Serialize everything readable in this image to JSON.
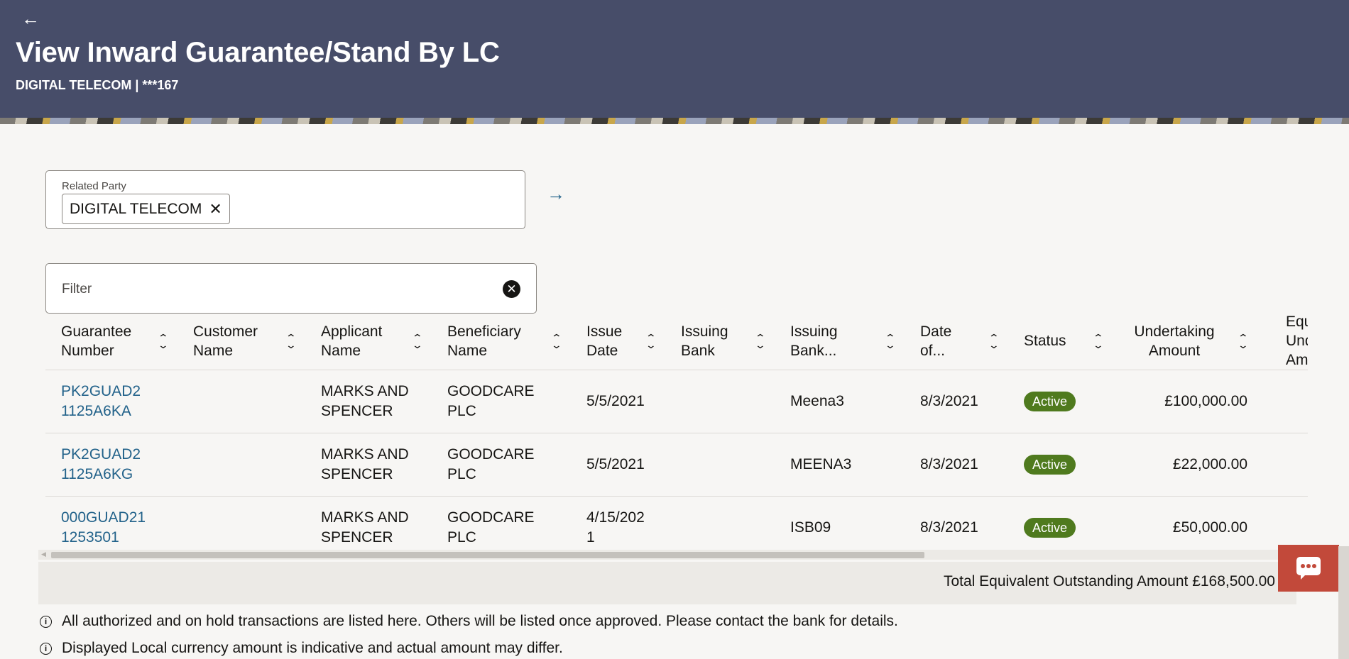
{
  "header": {
    "back_icon": "arrow-left-icon",
    "title": "View Inward Guarantee/Stand By LC",
    "subtitle": "DIGITAL TELECOM | ***167"
  },
  "related_party": {
    "label": "Related Party",
    "chip_value": "DIGITAL TELECOM",
    "remove_icon": "close-icon",
    "go_icon": "arrow-right-icon"
  },
  "filter": {
    "placeholder": "Filter",
    "clear_icon": "clear-circle-icon"
  },
  "table": {
    "columns": [
      "Guarantee Number",
      "Customer Name",
      "Applicant Name",
      "Beneficiary Name",
      "Issue Date",
      "Issuing Bank",
      "Issuing Bank...",
      "Date of...",
      "Status",
      "Undertaking Amount",
      "Equivalent Undertaking Amount"
    ],
    "rows": [
      {
        "guarantee_number": "PK2GUAD21125A6KA",
        "customer_name": "",
        "applicant_name": "MARKS AND SPENCER",
        "beneficiary_name": "GOODCARE PLC",
        "issue_date": "5/5/2021",
        "issuing_bank": "",
        "issuing_bank_ref": "Meena3",
        "date_of": "8/3/2021",
        "status": "Active",
        "undertaking_amount": "£100,000.00",
        "equivalent_amount": "£"
      },
      {
        "guarantee_number": "PK2GUAD21125A6KG",
        "customer_name": "",
        "applicant_name": "MARKS AND SPENCER",
        "beneficiary_name": "GOODCARE PLC",
        "issue_date": "5/5/2021",
        "issuing_bank": "",
        "issuing_bank_ref": "MEENA3",
        "date_of": "8/3/2021",
        "status": "Active",
        "undertaking_amount": "£22,000.00",
        "equivalent_amount": ""
      },
      {
        "guarantee_number": "000GUAD211253501",
        "customer_name": "",
        "applicant_name": "MARKS AND SPENCER",
        "beneficiary_name": "GOODCARE PLC",
        "issue_date": "4/15/2021",
        "issuing_bank": "",
        "issuing_bank_ref": "ISB09",
        "date_of": "8/3/2021",
        "status": "Active",
        "undertaking_amount": "£50,000.00",
        "equivalent_amount": ""
      }
    ],
    "sort_icon": "sort-up-down-icon"
  },
  "total": {
    "label": "Total Equivalent Outstanding Amount",
    "value": "£168,500.00"
  },
  "notes": [
    "All authorized and on hold transactions are listed here. Others will be listed once approved. Please contact the bank for details.",
    "Displayed Local currency amount is indicative and actual amount may differ."
  ],
  "chat": {
    "icon": "chat-icon"
  },
  "colors": {
    "header_bg": "#474d69",
    "link": "#22628a",
    "status_active": "#4f7a1e",
    "chat_bg": "#c2493a"
  }
}
